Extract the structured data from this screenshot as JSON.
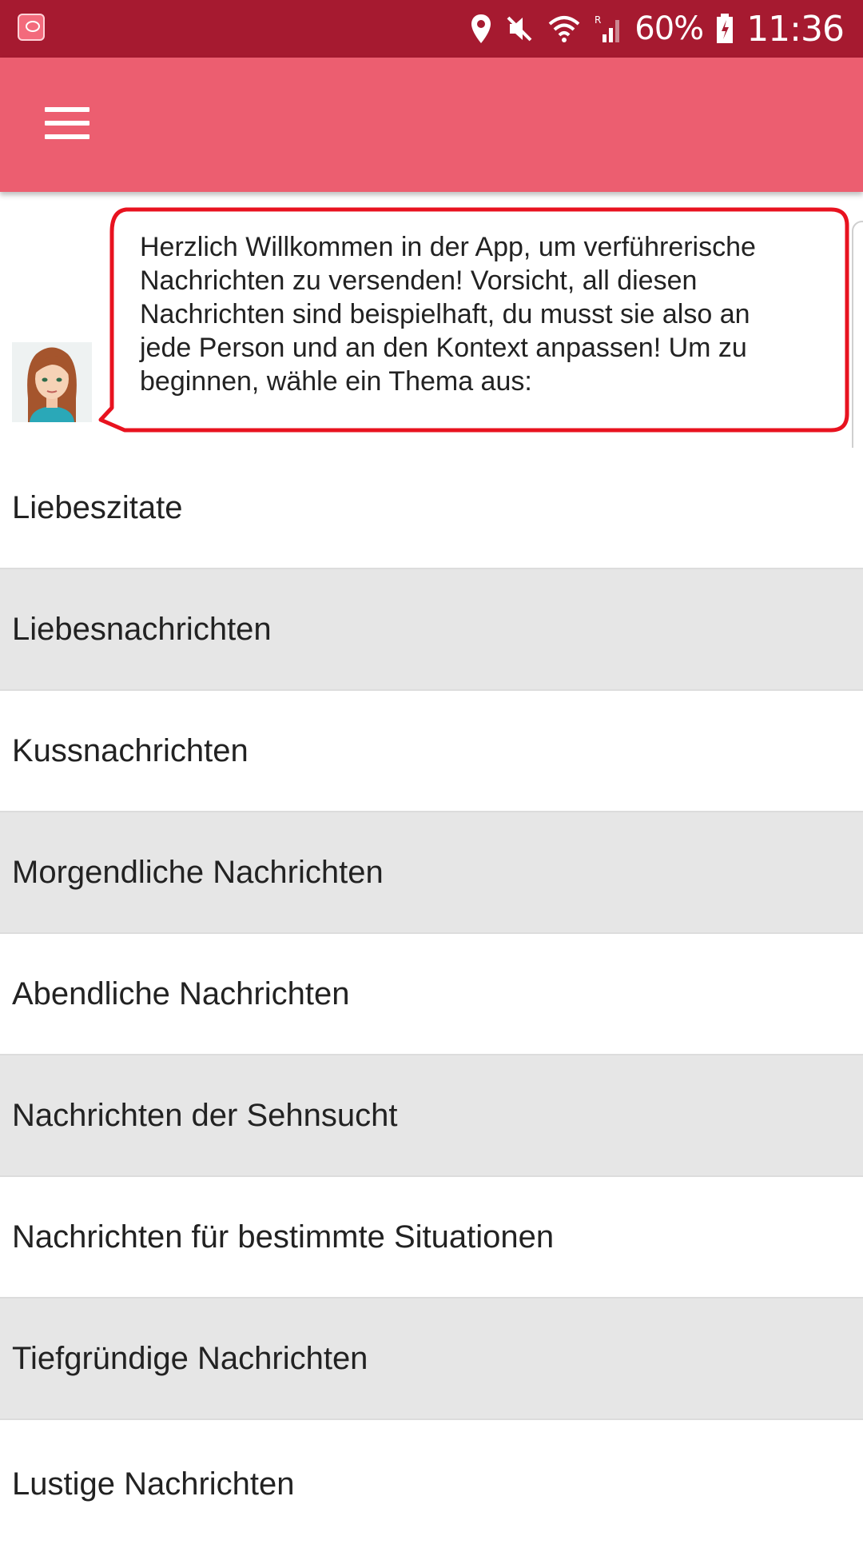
{
  "status_bar": {
    "battery": "60%",
    "time": "11:36",
    "icons": [
      "app-notification-icon",
      "location-icon",
      "mute-icon",
      "wifi-icon",
      "signal-icon",
      "battery-icon"
    ]
  },
  "app_bar": {
    "menu_icon": "hamburger-menu-icon",
    "color": "#ec5e70"
  },
  "welcome": {
    "avatar": "woman-avatar",
    "message": "Herzlich Willkommen in der App, um verführerische Nachrichten zu versenden! Vorsicht, all diesen Nachrichten sind beispielhaft, du musst sie also an jede Person und an den Kontext anpassen! Um zu beginnen, wähle ein Thema aus:",
    "bubble_border_color": "#e8121f"
  },
  "topics": [
    {
      "label": "Liebeszitate"
    },
    {
      "label": "Liebesnachrichten"
    },
    {
      "label": "Kussnachrichten"
    },
    {
      "label": "Morgendliche Nachrichten"
    },
    {
      "label": "Abendliche Nachrichten"
    },
    {
      "label": "Nachrichten der Sehnsucht"
    },
    {
      "label": "Nachrichten für bestimmte Situationen"
    },
    {
      "label": "Tiefgründige Nachrichten"
    },
    {
      "label": "Lustige Nachrichten"
    }
  ],
  "colors": {
    "status_bar": "#a61a30",
    "app_bar": "#ec5e70",
    "list_alt_row": "#e6e6e6"
  }
}
